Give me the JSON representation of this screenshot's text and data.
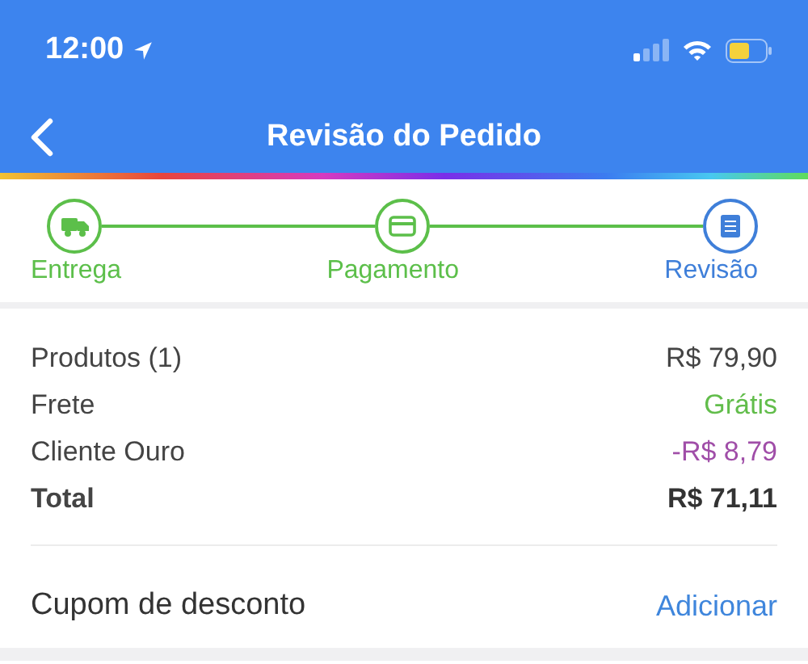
{
  "status_bar": {
    "time": "12:00"
  },
  "nav_bar": {
    "title": "Revisão do Pedido"
  },
  "steps": [
    {
      "label": "Entrega",
      "kind": "truck",
      "selected": false
    },
    {
      "label": "Pagamento",
      "kind": "card",
      "selected": false
    },
    {
      "label": "Revisão",
      "kind": "document",
      "selected": true
    }
  ],
  "summary": [
    {
      "label": "Produtos (1)",
      "value": "R$ 79,90",
      "kind": "normal"
    },
    {
      "label": "Frete",
      "value": "Grátis",
      "kind": "free"
    },
    {
      "label": "Cliente Ouro",
      "value": "-R$ 8,79",
      "kind": "discount"
    },
    {
      "label": "Total",
      "value": "R$ 71,11",
      "kind": "total"
    }
  ],
  "coupon": {
    "label": "Cupom de desconto",
    "action": "Adicionar"
  }
}
